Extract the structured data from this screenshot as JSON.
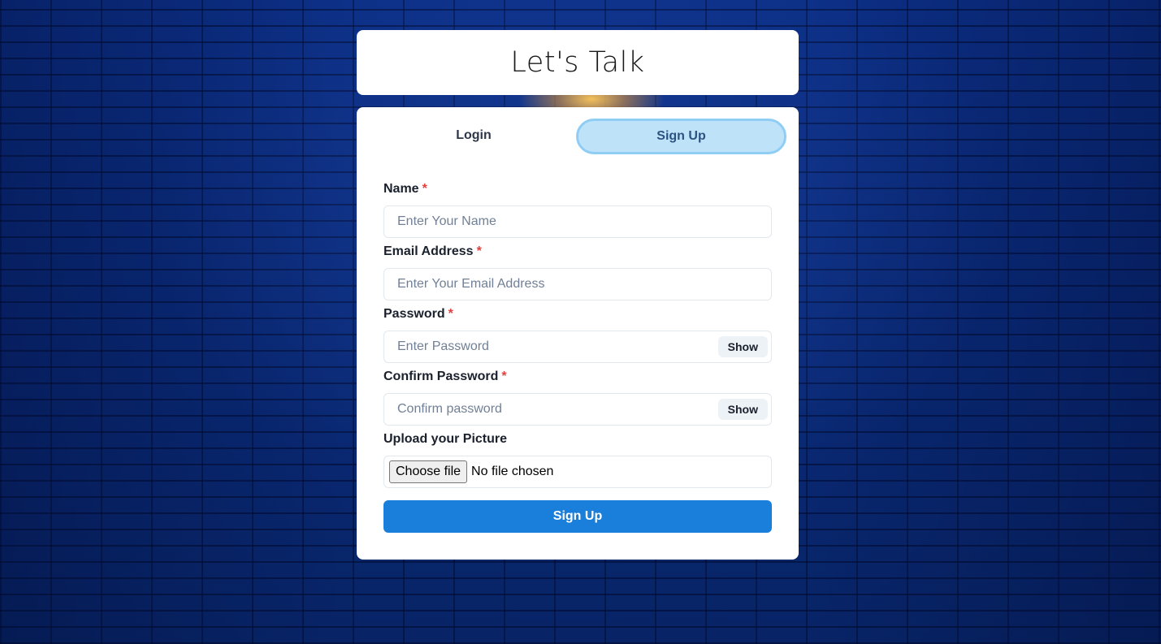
{
  "header": {
    "title": "Let's Talk"
  },
  "tabs": [
    {
      "label": "Login",
      "active": false
    },
    {
      "label": "Sign Up",
      "active": true
    }
  ],
  "form": {
    "required_marker": "*",
    "name": {
      "label": "Name",
      "placeholder": "Enter Your Name",
      "value": ""
    },
    "email": {
      "label": "Email Address",
      "placeholder": "Enter Your Email Address",
      "value": ""
    },
    "password": {
      "label": "Password",
      "placeholder": "Enter Password",
      "value": "",
      "toggle_label": "Show"
    },
    "confirm_password": {
      "label": "Confirm Password",
      "placeholder": "Confirm password",
      "value": "",
      "toggle_label": "Show"
    },
    "picture": {
      "label": "Upload your Picture",
      "button_label": "Choose file",
      "status": "No file chosen"
    },
    "submit_label": "Sign Up"
  },
  "colors": {
    "background": "#0a2a7a",
    "active_tab_bg": "#bee3f8",
    "active_tab_border": "#90cdf4",
    "primary_button": "#1a7fdb",
    "required": "#e53e3e"
  }
}
